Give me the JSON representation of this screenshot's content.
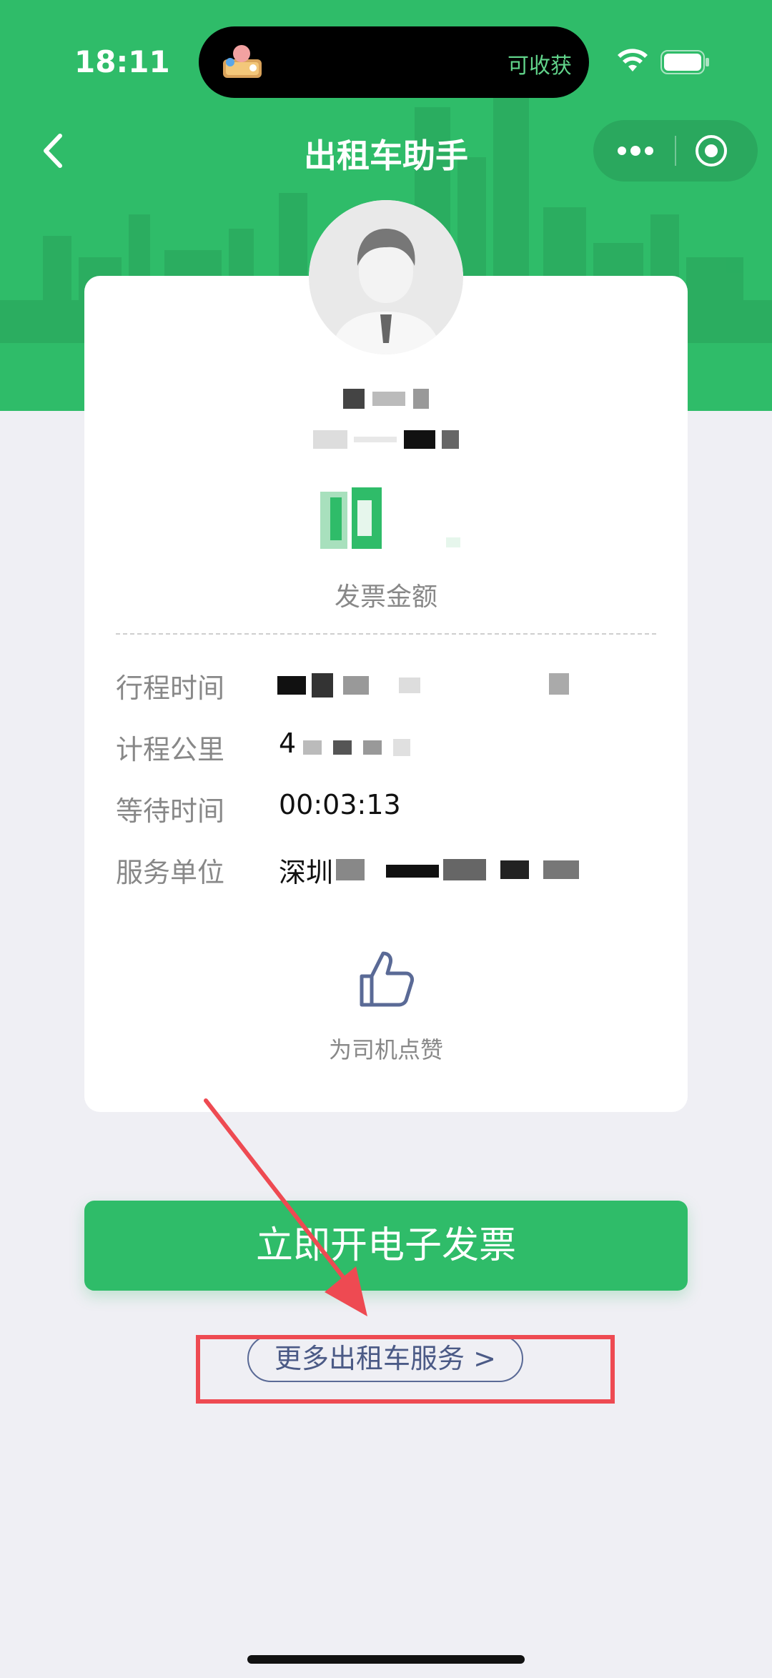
{
  "status_bar": {
    "time": "18:11",
    "island_text": "可收获",
    "icons": [
      "wifi-icon",
      "battery-icon"
    ]
  },
  "nav": {
    "title": "出租车助手",
    "back_icon": "chevron-left-icon",
    "menu_icons": [
      "more-dots-icon",
      "target-icon"
    ]
  },
  "card": {
    "amount_label": "发票金额",
    "rows": [
      {
        "label": "行程时间",
        "value": ""
      },
      {
        "label": "计程公里",
        "value": "4"
      },
      {
        "label": "等待时间",
        "value": "00:03:13"
      },
      {
        "label": "服务单位",
        "value": "深圳"
      }
    ],
    "like_label": "为司机点赞"
  },
  "buttons": {
    "invoice": "立即开电子发票",
    "more_services": "更多出租车服务 >"
  },
  "colors": {
    "brand_green": "#2fbc69",
    "highlight_red": "#ee4a52",
    "link_blue": "#4b5a86"
  }
}
